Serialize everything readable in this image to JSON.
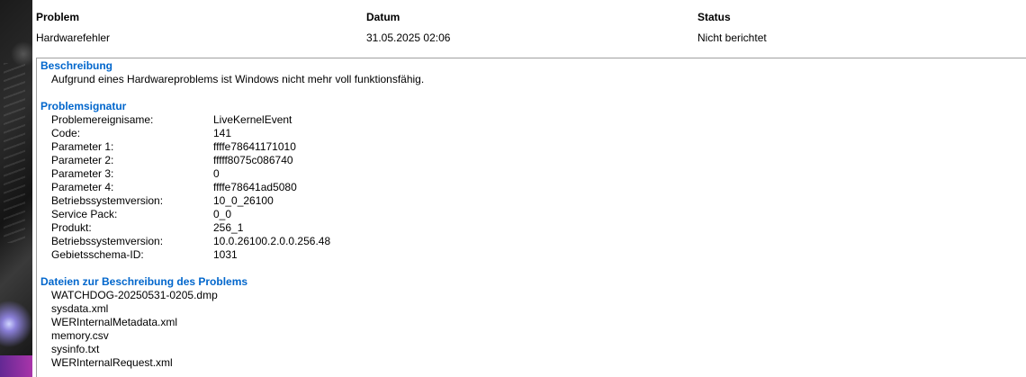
{
  "header": {
    "columns": [
      "Problem",
      "Datum",
      "Status"
    ],
    "row": {
      "problem": "Hardwarefehler",
      "datum": "31.05.2025 02:06",
      "status": "Nicht berichtet"
    }
  },
  "beschreibung": {
    "title": "Beschreibung",
    "text": "Aufgrund eines Hardwareproblems ist Windows nicht mehr voll funktionsfähig."
  },
  "signatur": {
    "title": "Problemsignatur",
    "items": [
      {
        "key": "Problemereignisame:",
        "value": "LiveKernelEvent"
      },
      {
        "key": "Code:",
        "value": "141"
      },
      {
        "key": "Parameter 1:",
        "value": "ffffe78641171010"
      },
      {
        "key": "Parameter 2:",
        "value": "fffff8075c086740"
      },
      {
        "key": "Parameter 3:",
        "value": "0"
      },
      {
        "key": "Parameter 4:",
        "value": "ffffe78641ad5080"
      },
      {
        "key": "Betriebssystemversion:",
        "value": "10_0_26100"
      },
      {
        "key": "Service Pack:",
        "value": "0_0"
      },
      {
        "key": "Produkt:",
        "value": "256_1"
      },
      {
        "key": "Betriebssystemversion:",
        "value": "10.0.26100.2.0.0.256.48"
      },
      {
        "key": "Gebietsschema-ID:",
        "value": "1031"
      }
    ]
  },
  "dateien": {
    "title": "Dateien zur Beschreibung des Problems",
    "files": [
      "WATCHDOG-20250531-0205.dmp",
      "sysdata.xml",
      "WERInternalMetadata.xml",
      "memory.csv",
      "sysinfo.txt",
      "WERInternalRequest.xml"
    ]
  }
}
